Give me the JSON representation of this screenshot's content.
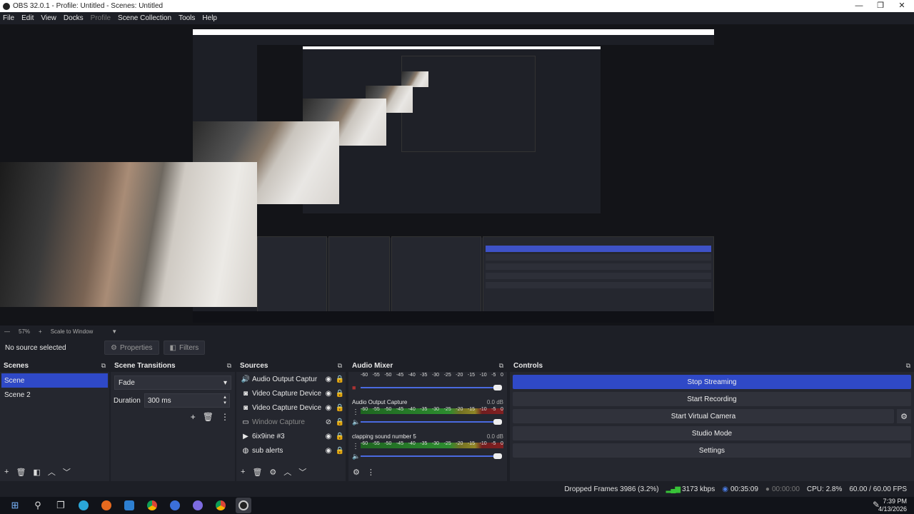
{
  "window": {
    "title": "OBS 32.0.1 - Profile: Untitled - Scenes: Untitled",
    "minimize": "—",
    "restore": "❐",
    "close": "✕"
  },
  "menu": [
    "File",
    "Edit",
    "View",
    "Docks",
    "Profile",
    "Scene Collection",
    "Tools",
    "Help"
  ],
  "zoom": {
    "level": "57%",
    "scale": "Scale to Window"
  },
  "sourcebar": {
    "no_source": "No source selected",
    "properties": "Properties",
    "filters": "Filters"
  },
  "scenes": {
    "title": "Scenes",
    "items": [
      "Scene",
      "Scene 2"
    ]
  },
  "transitions": {
    "title": "Scene Transitions",
    "selected": "Fade",
    "duration_label": "Duration",
    "duration_value": "300 ms"
  },
  "sources": {
    "title": "Sources",
    "items": [
      {
        "name": "Audio Output Captur",
        "icon": "speaker-icon"
      },
      {
        "name": "Video Capture Device",
        "icon": "camera-icon"
      },
      {
        "name": "Video Capture Device",
        "icon": "camera-icon"
      },
      {
        "name": "Window Capture",
        "icon": "window-icon"
      },
      {
        "name": "6ix9ine #3",
        "icon": "play-icon"
      },
      {
        "name": "sub alerts",
        "icon": "globe-icon"
      }
    ]
  },
  "mixer": {
    "title": "Audio Mixer",
    "scale": [
      "-60",
      "-55",
      "-50",
      "-45",
      "-40",
      "-35",
      "-30",
      "-25",
      "-20",
      "-15",
      "-10",
      "-5",
      "0"
    ],
    "tracks": [
      {
        "name": "Audio Output Capture",
        "db": "0.0 dB"
      },
      {
        "name": "clapping sound number 5",
        "db": "0.0 dB"
      }
    ]
  },
  "controls": {
    "title": "Controls",
    "stop_streaming": "Stop Streaming",
    "start_recording": "Start Recording",
    "start_virtual_camera": "Start Virtual Camera",
    "studio_mode": "Studio Mode",
    "settings": "Settings"
  },
  "status": {
    "dropped": "Dropped Frames 3986 (3.2%)",
    "bitrate": "3173 kbps",
    "stream_time": "00:35:09",
    "rec_time": "00:00:00",
    "cpu": "CPU: 2.8%",
    "fps": "60.00 / 60.00 FPS"
  },
  "clock": {
    "time": "7:39 PM",
    "date": "4/13/2026"
  },
  "colors": {
    "accent": "#2f49c7",
    "bg": "#1d1f26",
    "dock": "#25272f"
  }
}
